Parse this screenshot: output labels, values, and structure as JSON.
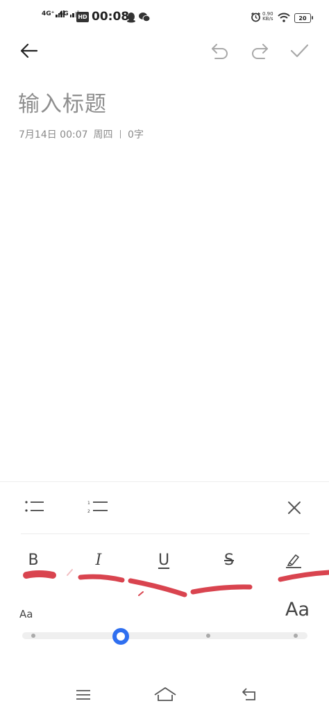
{
  "status_bar": {
    "sim1": "4G⁺",
    "sim2": "4G",
    "hd": "HD",
    "time": "00:08",
    "net_speed_value": "0.90",
    "net_speed_unit": "KB/s",
    "battery": "20"
  },
  "editor": {
    "title_placeholder": "输入标题",
    "date": "7月14日 00:07",
    "weekday": "周四",
    "word_count": "0字"
  },
  "format_panel": {
    "bold_label": "B",
    "italic_label": "I",
    "underline_label": "U",
    "strike_label": "S",
    "font_size_small": "Aa",
    "font_size_large": "Aa",
    "font_size_level": 0.33
  },
  "colors": {
    "accent": "#2f6ff0",
    "annotation": "#d9444f"
  }
}
